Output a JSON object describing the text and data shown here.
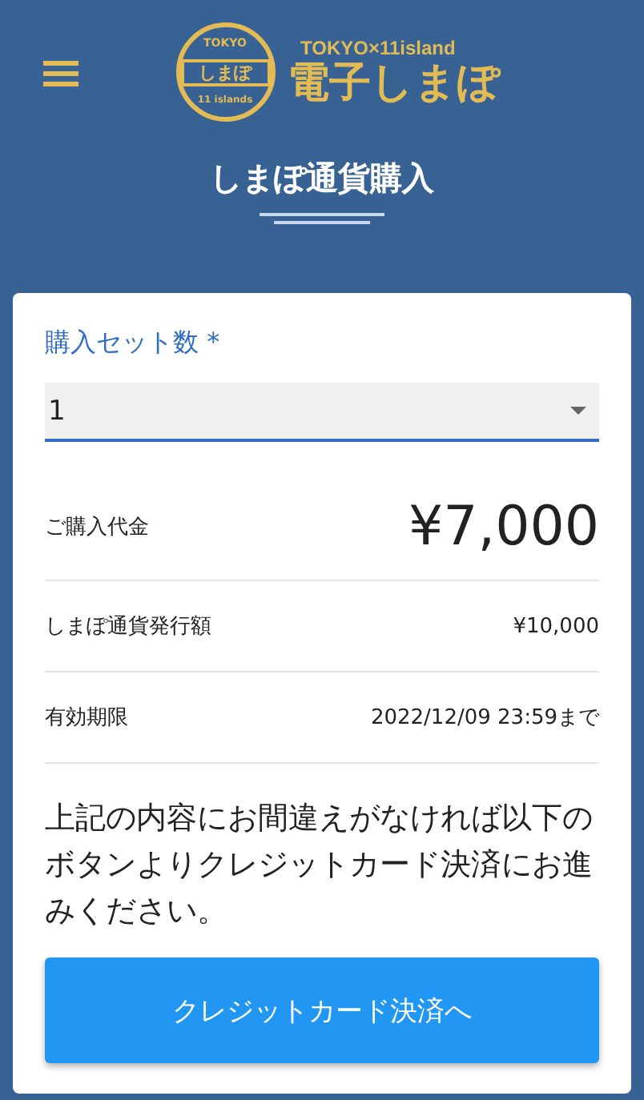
{
  "header": {
    "logo": {
      "badge_top": "TOKYO",
      "badge_ribbon": "しまぽ",
      "badge_bottom": "11 islands",
      "tagline": "TOKYO×11island",
      "name": "電子しまぽ"
    },
    "page_title": "しまぽ通貨購入"
  },
  "form": {
    "label": "購入セット数",
    "required_mark": "*",
    "value": "1"
  },
  "rows": [
    {
      "kind": "large",
      "label": "ご購入代金",
      "value": "¥7,000"
    },
    {
      "kind": "normal",
      "label": "しまぽ通貨発行額",
      "value": "¥10,000"
    },
    {
      "kind": "normal",
      "label": "有効期限",
      "value": "2022/12/09 23:59まで"
    }
  ],
  "notice": "上記の内容にお間違えがなければ以下のボタンよりクレジットカード決済にお進みください。",
  "button": "クレジットカード決済へ"
}
